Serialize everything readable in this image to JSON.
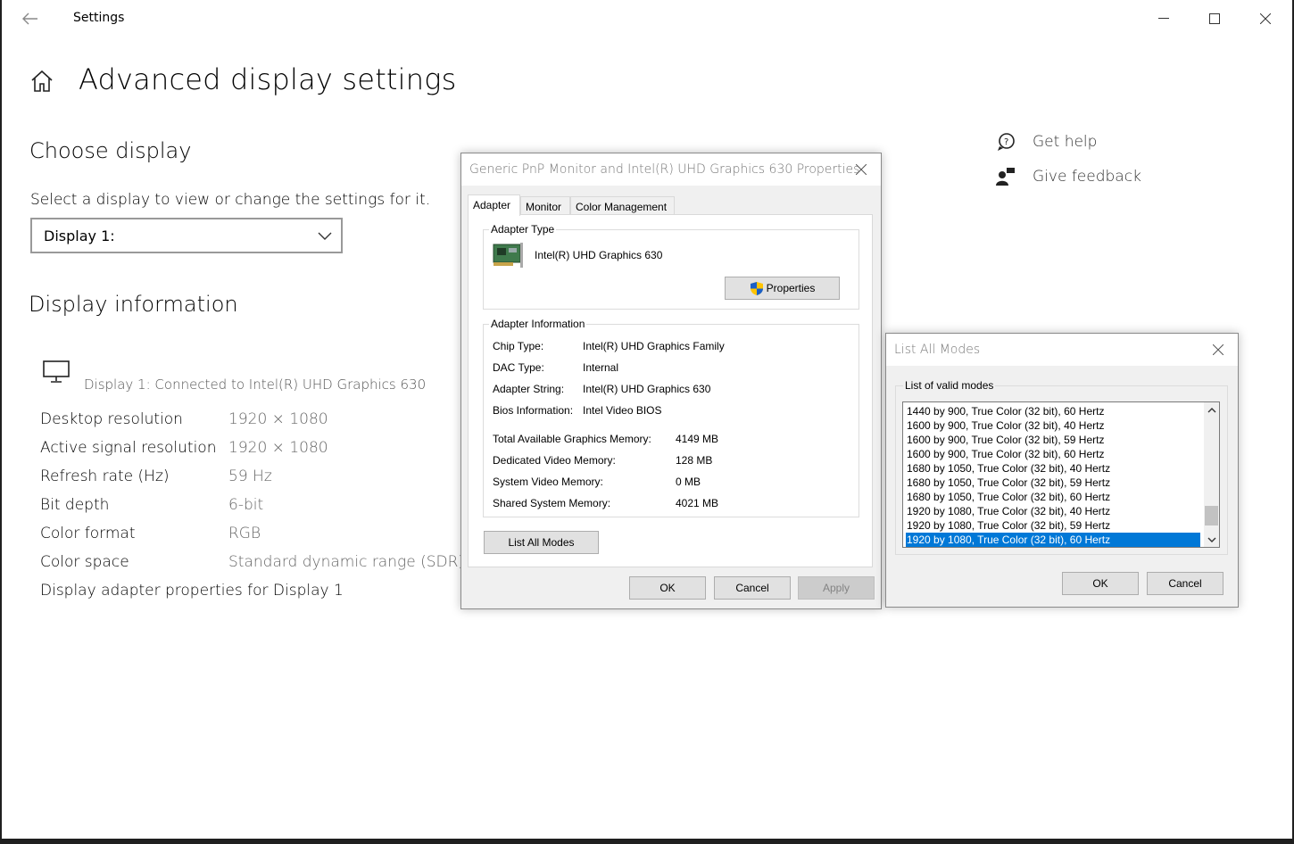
{
  "window": {
    "title": "Settings",
    "back_icon": "arrow-left-icon",
    "minimize": "–",
    "maximize": "☐",
    "close": "✕"
  },
  "page": {
    "title": "Advanced display settings"
  },
  "choose_display": {
    "heading": "Choose display",
    "prompt": "Select a display to view or change the settings for it.",
    "selected": "Display 1:"
  },
  "display_info": {
    "heading": "Display information",
    "connected": "Display 1: Connected to Intel(R) UHD Graphics 630",
    "rows": [
      {
        "label": "Desktop resolution",
        "value": "1920 × 1080"
      },
      {
        "label": "Active signal resolution",
        "value": "1920 × 1080"
      },
      {
        "label": "Refresh rate (Hz)",
        "value": "59 Hz"
      },
      {
        "label": "Bit depth",
        "value": "6-bit"
      },
      {
        "label": "Color format",
        "value": "RGB"
      },
      {
        "label": "Color space",
        "value": "Standard dynamic range (SDR)"
      }
    ],
    "adapter_link": "Display adapter properties for Display 1"
  },
  "side_links": {
    "help": "Get help",
    "feedback": "Give feedback"
  },
  "properties_dialog": {
    "title": "Generic PnP Monitor and Intel(R) UHD Graphics 630 Properties",
    "tabs": [
      "Adapter",
      "Monitor",
      "Color Management"
    ],
    "adapter_type_label": "Adapter Type",
    "adapter_name": "Intel(R) UHD Graphics 630",
    "properties_button": "Properties",
    "adapter_info_label": "Adapter Information",
    "info": [
      {
        "label": "Chip Type:",
        "value": "Intel(R) UHD Graphics Family"
      },
      {
        "label": "DAC Type:",
        "value": "Internal"
      },
      {
        "label": "Adapter String:",
        "value": "Intel(R) UHD Graphics 630"
      },
      {
        "label": "Bios Information:",
        "value": "Intel Video BIOS"
      }
    ],
    "memory": [
      {
        "label": "Total Available Graphics Memory:",
        "value": "4149 MB"
      },
      {
        "label": "Dedicated Video Memory:",
        "value": "128 MB"
      },
      {
        "label": "System Video Memory:",
        "value": "0 MB"
      },
      {
        "label": "Shared System Memory:",
        "value": "4021 MB"
      }
    ],
    "list_all_modes_button": "List All Modes",
    "ok": "OK",
    "cancel": "Cancel",
    "apply": "Apply"
  },
  "modes_dialog": {
    "title": "List All Modes",
    "group_label": "List of valid modes",
    "modes": [
      "1440 by 900, True Color (32 bit), 60 Hertz",
      "1600 by 900, True Color (32 bit), 40 Hertz",
      "1600 by 900, True Color (32 bit), 59 Hertz",
      "1600 by 900, True Color (32 bit), 60 Hertz",
      "1680 by 1050, True Color (32 bit), 40 Hertz",
      "1680 by 1050, True Color (32 bit), 59 Hertz",
      "1680 by 1050, True Color (32 bit), 60 Hertz",
      "1920 by 1080, True Color (32 bit), 40 Hertz",
      "1920 by 1080, True Color (32 bit), 59 Hertz",
      "1920 by 1080, True Color (32 bit), 60 Hertz"
    ],
    "selected_index": 9,
    "ok": "OK",
    "cancel": "Cancel"
  },
  "colors": {
    "accent": "#0078d7",
    "dialog_bg": "#f0f0f0"
  }
}
